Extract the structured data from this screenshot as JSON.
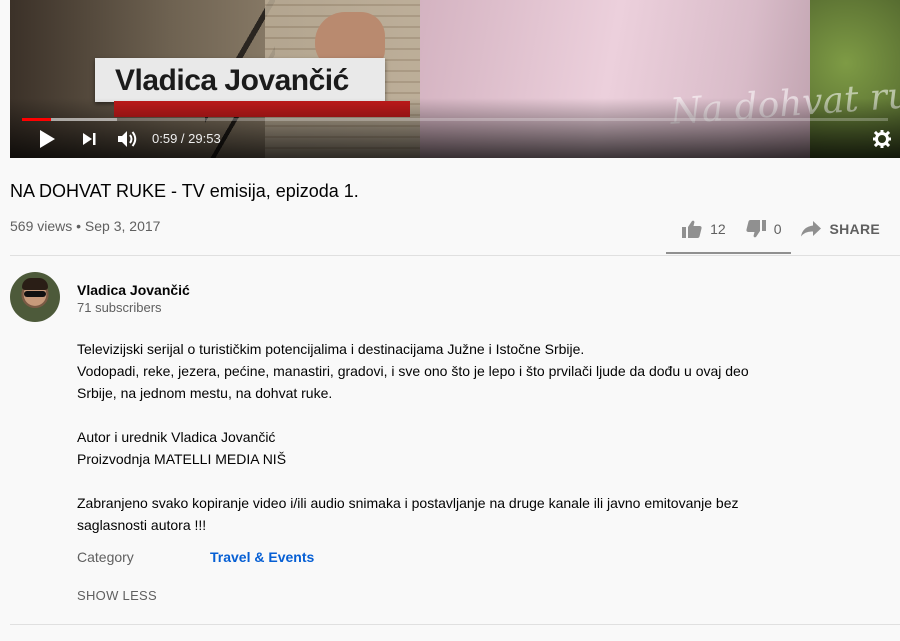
{
  "player": {
    "lower_third_name": "Vladica Jovančić",
    "watermark": "Na dohvat ruke",
    "time_display": "0:59 / 29:53",
    "progress_played": 0.033,
    "progress_buffered": 0.11,
    "colors": {
      "progress": "#ff0000",
      "lower_third_bar": "#c11a1a"
    },
    "icons": [
      "play-icon",
      "next-icon",
      "volume-icon",
      "settings-icon"
    ]
  },
  "video": {
    "title": "NA DOHVAT RUKE - TV emisija, epizoda 1.",
    "meta": "569 views • Sep 3, 2017",
    "likes": "12",
    "dislikes": "0",
    "share_label": "SHARE"
  },
  "channel": {
    "name": "Vladica Jovančić",
    "subscribers": "71 subscribers"
  },
  "description": {
    "paragraphs": [
      "Televizijski serijal o turističkim potencijalima i destinacijama Južne i Istočne Srbije.\nVodopadi, reke, jezera, pećine, manastiri, gradovi, i sve ono što je lepo i što prvilači ljude da dođu u ovaj deo Srbije, na jednom mestu, na dohvat ruke.",
      "Autor i urednik  Vladica Jovančić\nProizvodnja  MATELLI MEDIA NIŠ",
      "Zabranjeno svako kopiranje video i/ili audio snimaka i postavljanje na druge kanale ili javno emitovanje bez saglasnosti autora !!!"
    ],
    "category_label": "Category",
    "category_value": "Travel & Events",
    "category_color": "#065fd4",
    "show_less_label": "SHOW LESS"
  }
}
